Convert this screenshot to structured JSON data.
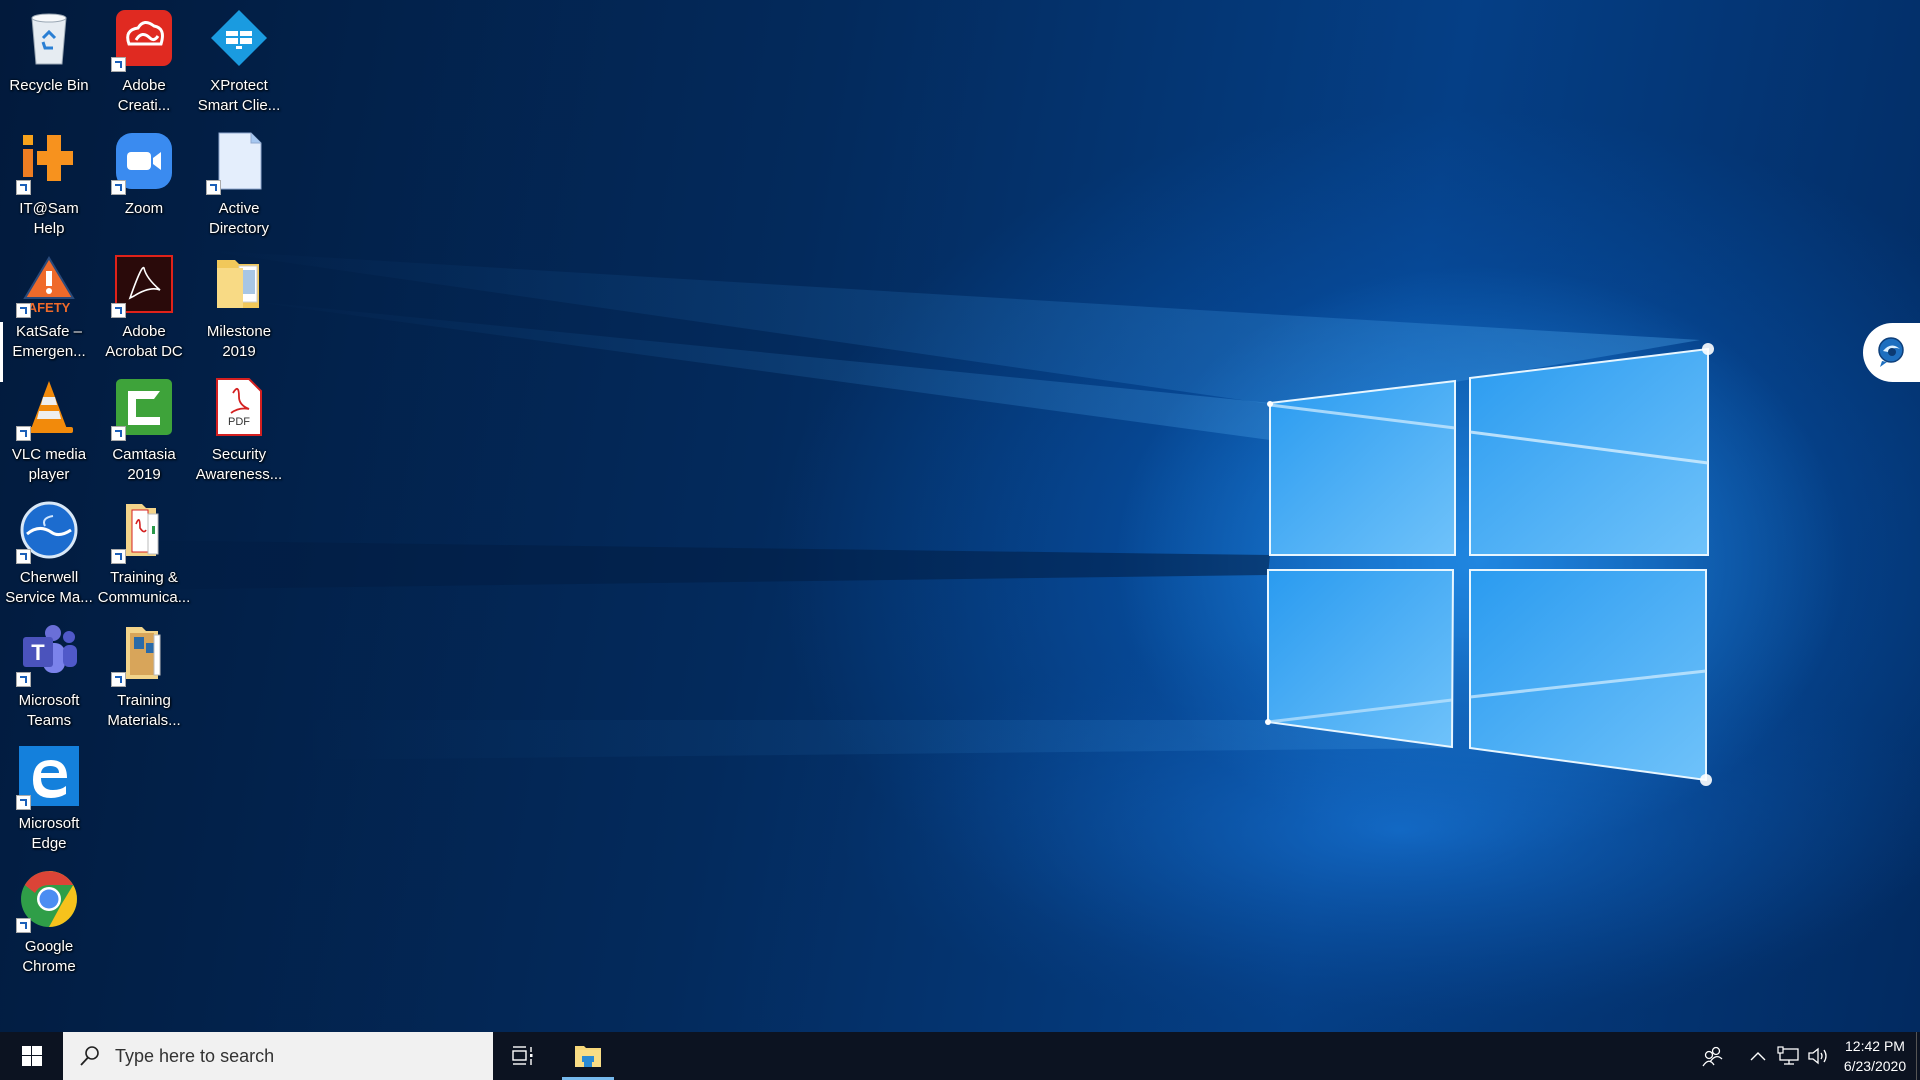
{
  "desktop": {
    "icons": [
      {
        "id": "recycle-bin",
        "label": "Recycle Bin",
        "icon": "recycle-bin-icon",
        "shortcut": false
      },
      {
        "id": "adobe-creative-cloud",
        "label": "Adobe Creati...",
        "icon": "adobe-creative-cloud-icon",
        "shortcut": true
      },
      {
        "id": "xprotect-smart-client",
        "label": "XProtect Smart Clie...",
        "icon": "xprotect-icon",
        "shortcut": false
      },
      {
        "id": "itsam-help",
        "label": "IT@Sam Help",
        "icon": "itsam-help-icon",
        "shortcut": true
      },
      {
        "id": "zoom",
        "label": "Zoom",
        "icon": "zoom-icon",
        "shortcut": true
      },
      {
        "id": "active-directory",
        "label": "Active Directory",
        "icon": "document-icon",
        "shortcut": true
      },
      {
        "id": "katsafe",
        "label": "KatSafe – Emergen...",
        "icon": "safety-warning-icon",
        "shortcut": true
      },
      {
        "id": "adobe-acrobat-dc",
        "label": "Adobe Acrobat DC",
        "icon": "adobe-acrobat-icon",
        "shortcut": true
      },
      {
        "id": "milestone-2019",
        "label": "Milestone 2019",
        "icon": "folder-icon",
        "shortcut": false
      },
      {
        "id": "vlc",
        "label": "VLC media player",
        "icon": "vlc-icon",
        "shortcut": true
      },
      {
        "id": "camtasia-2019",
        "label": "Camtasia 2019",
        "icon": "camtasia-icon",
        "shortcut": true
      },
      {
        "id": "security-awareness",
        "label": "Security Awareness...",
        "icon": "pdf-icon",
        "shortcut": false
      },
      {
        "id": "cherwell",
        "label": "Cherwell Service Ma...",
        "icon": "cherwell-icon",
        "shortcut": true
      },
      {
        "id": "training-communications",
        "label": "Training & Communica...",
        "icon": "pdf-folder-icon",
        "shortcut": true
      },
      {
        "id": "microsoft-teams",
        "label": "Microsoft Teams",
        "icon": "teams-icon",
        "shortcut": true
      },
      {
        "id": "training-materials",
        "label": "Training Materials...",
        "icon": "media-folder-icon",
        "shortcut": true
      },
      {
        "id": "microsoft-edge",
        "label": "Microsoft Edge",
        "icon": "edge-icon",
        "shortcut": true
      },
      {
        "id": "google-chrome",
        "label": "Google Chrome",
        "icon": "chrome-icon",
        "shortcut": true
      }
    ]
  },
  "taskbar": {
    "start_icon": "windows-start-icon",
    "search_placeholder": "Type here to search",
    "task_view_icon": "task-view-icon",
    "pinned": [
      {
        "name": "File Explorer",
        "icon": "file-explorer-icon",
        "active": true
      }
    ],
    "tray": {
      "people_icon": "people-icon",
      "overflow_icon": "chevron-up-icon",
      "network_icon": "network-icon",
      "volume_icon": "volume-icon",
      "time": "12:42 PM",
      "date": "6/23/2020"
    }
  },
  "side_widget": {
    "icon": "chat-bubble-icon"
  },
  "colors": {
    "taskbar": "#0c1321",
    "search_bg": "#f1f1f1",
    "accent": "#76b9ed",
    "wallpaper_blue": "#0a5fc0"
  }
}
